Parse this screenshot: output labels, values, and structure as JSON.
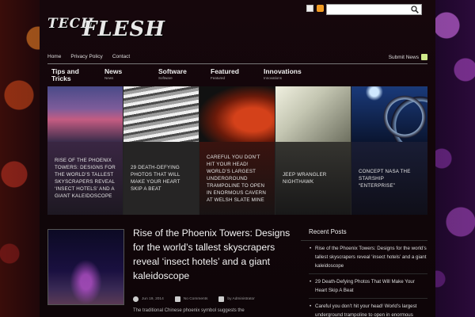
{
  "logo": {
    "part1": "TECH",
    "part2": "FLESH"
  },
  "search": {
    "placeholder": ""
  },
  "topnav": {
    "items": [
      "Home",
      "Privacy Policy",
      "Contact"
    ],
    "submit": "Submit News"
  },
  "categories": [
    {
      "title": "Tips and Tricks",
      "sub": ""
    },
    {
      "title": "News",
      "sub": "News"
    },
    {
      "title": "Software",
      "sub": "Software"
    },
    {
      "title": "Featured",
      "sub": "Featured"
    },
    {
      "title": "Innovations",
      "sub": "Innovations"
    }
  ],
  "slides": [
    {
      "caption": "Rise of the Phoenix Towers: Designs for the world’s tallest skyscrapers reveal ‘insect hotels’ and a giant kaleidoscope"
    },
    {
      "caption": "29 Death-Defying Photos That Will Make Your Heart Skip A Beat"
    },
    {
      "caption": "Careful you don’t hit your head! World’s largest underground trampoline to open in enormous cavern at Welsh slate mine"
    },
    {
      "caption": "Jeep Wrangler Nighthawk"
    },
    {
      "caption": "Concept NASA the Starship “Enterprise”"
    }
  ],
  "post": {
    "title": "Rise of the Phoenix Towers: Designs for the world’s tallest skyscrapers reveal ‘insect hotels’ and a giant kaleidoscope",
    "date": "Jun 19, 2014",
    "comments": "No Comments",
    "author": "by Administrator",
    "excerpt": "The traditional Chinese phoenix symbol suggests the"
  },
  "sidebar": {
    "heading": "Recent Posts",
    "items": [
      "Rise of the Phoenix Towers: Designs for the world’s tallest skyscrapers reveal ‘insect hotels’ and a giant kaleidoscope",
      "29 Death-Defying Photos That Will Make Your Heart Skip A Beat",
      "Careful you don’t hit your head! World’s largest underground trampoline to open in enormous cavern at Welsh slate mine"
    ]
  }
}
